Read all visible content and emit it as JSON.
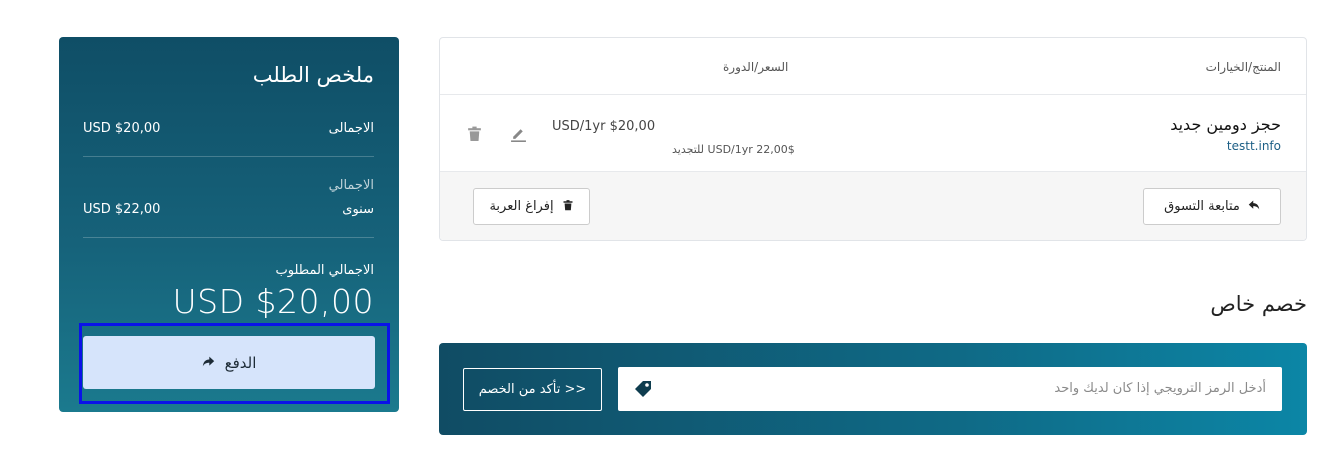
{
  "summary": {
    "title": "ملخص الطلب",
    "subtotal_label": "الاجمالى",
    "subtotal_value": "USD $20,00",
    "recurring_label": "الاجمالي",
    "recurring_period": "سنوى",
    "recurring_value": "USD $22,00",
    "total_due_label": "الاجمالي المطلوب",
    "total_due_value": "USD $20,00",
    "checkout_label": "الدفع",
    "colors": {
      "panel": "#0f4e66",
      "checkout_bg": "#d6e4fb",
      "highlight": "#0a12e8"
    }
  },
  "cart": {
    "headers": {
      "product": "المنتج/الخيارات",
      "price": "السعر/الدورة"
    },
    "items": [
      {
        "name": "حجز دومين جديد",
        "domain": "testt.info",
        "price": "USD/1yr $20,00",
        "renewal": "USD/1yr 22,00$ للتجديد"
      }
    ],
    "continue_label": "متابعة التسوق",
    "empty_label": "إفراغ العربة"
  },
  "promo": {
    "title": "خصم خاص",
    "placeholder": "أدخل الرمز الترويجي إذا كان لديك واحد",
    "validate_label": "تأكد من الخصم >>"
  },
  "icons": {
    "checkout": "share-arrow-icon",
    "delete": "trash-icon",
    "edit": "pencil-icon",
    "continue": "reply-arrow-icon",
    "empty": "trash-icon",
    "promo": "tag-icon"
  }
}
